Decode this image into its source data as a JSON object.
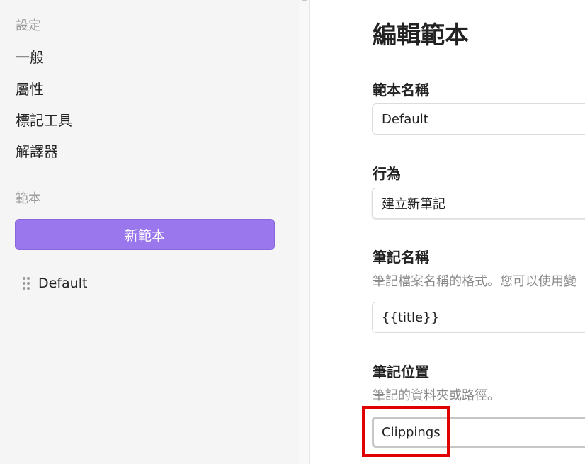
{
  "sidebar": {
    "settings_heading": "設定",
    "items": [
      {
        "label": "一般"
      },
      {
        "label": "屬性"
      },
      {
        "label": "標記工具"
      },
      {
        "label": "解譯器"
      }
    ],
    "templates_heading": "範本",
    "new_template_label": "新範本",
    "templates": [
      {
        "label": "Default"
      }
    ]
  },
  "editor": {
    "title": "編輯範本",
    "template_name": {
      "label": "範本名稱",
      "value": "Default"
    },
    "behavior": {
      "label": "行為",
      "value": "建立新筆記"
    },
    "note_name": {
      "label": "筆記名稱",
      "description": "筆記檔案名稱的格式。您可以使用變",
      "value": "{{title}}"
    },
    "note_location": {
      "label": "筆記位置",
      "description": "筆記的資料夾或路徑。",
      "value": "Clippings"
    }
  },
  "colors": {
    "accent": "#9b77ee",
    "highlight": "#e00000",
    "sidebar_bg": "#f5f5f5"
  },
  "icons": {
    "drag_handle": "drag-handle-icon"
  }
}
